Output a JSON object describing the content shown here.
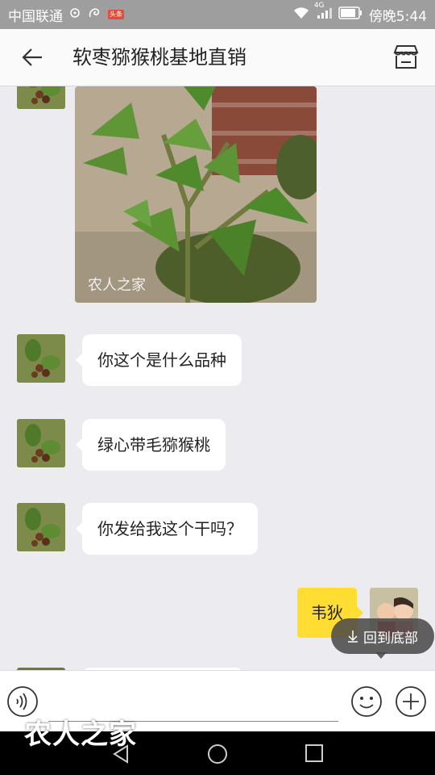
{
  "status_bar": {
    "carrier": "中国联通",
    "news_badge": "头条",
    "signal_label": "4G",
    "time": "傍晚5:44"
  },
  "header": {
    "title": "软枣猕猴桃基地直销",
    "back_icon": "arrow-left-icon",
    "store_icon": "store-icon"
  },
  "photo_message": {
    "watermark": "农人之家"
  },
  "messages": [
    {
      "from": "other",
      "text": "你这个是什么品种"
    },
    {
      "from": "other",
      "text": "绿心带毛猕猴桃"
    },
    {
      "from": "other",
      "text": "你发给我这个干吗？"
    },
    {
      "from": "me",
      "text": "韦狄"
    }
  ],
  "back_to_bottom": {
    "label": "回到底部"
  },
  "input": {
    "value": "",
    "placeholder": ""
  },
  "watermark_bottom": "农人之家",
  "colors": {
    "status_bar": "#9e9e9e",
    "my_bubble": "#ffdd33",
    "other_bubble": "#ffffff",
    "chat_bg": "#ececf0"
  }
}
